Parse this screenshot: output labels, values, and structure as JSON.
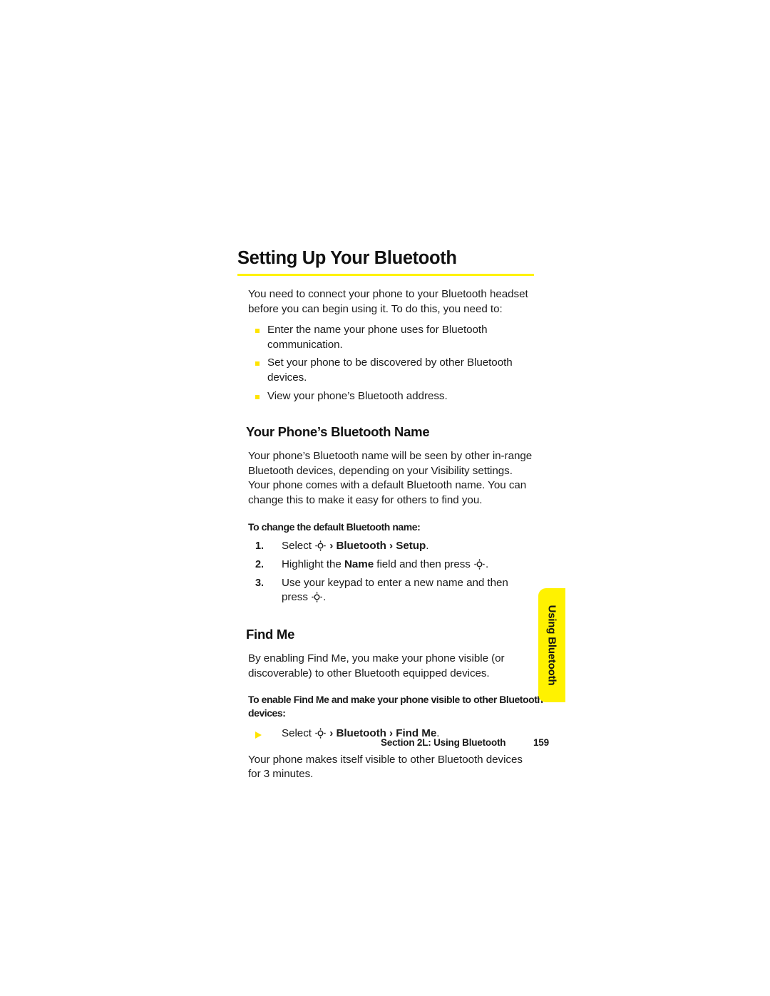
{
  "page": {
    "chapter_title": "Setting Up Your Bluetooth",
    "rule_color": "#fff200",
    "bullet_color": "#ffe400"
  },
  "intro": {
    "paragraph": "You need to connect your phone to your Bluetooth headset before you can begin using it. To do this, you need to:",
    "bullets": [
      "Enter the name your phone uses for Bluetooth communication.",
      "Set your phone to be discovered by other Bluetooth devices.",
      "View your phone’s Bluetooth address."
    ]
  },
  "bluetooth_name": {
    "heading": "Your Phone’s Bluetooth Name",
    "paragraph": "Your phone’s Bluetooth name will be seen by other in-range Bluetooth devices, depending on your Visibility settings. Your phone comes with a default Bluetooth name. You can change this to make it easy for others to find you.",
    "lead_in": "To change the default Bluetooth name:",
    "steps": [
      {
        "number": "1.",
        "pre": "Select ",
        "icon": "nav-key-icon",
        "post_plain_1": " ",
        "arrow_1": "›",
        "bold_1": "Bluetooth",
        "arrow_2": "›",
        "bold_2": "Setup",
        "tail": ".",
        "text": "Select [nav-key] › Bluetooth › Setup."
      },
      {
        "number": "2.",
        "text": "Highlight the Name field and then press [nav-key].",
        "pre": "Highlight the ",
        "bold_1": "Name",
        "mid": " field and then press ",
        "icon": "nav-key-icon",
        "tail": "."
      },
      {
        "number": "3.",
        "text": "Use your keypad to enter a new name and then press [nav-key].",
        "pre": "Use your keypad to enter a new name and then press ",
        "icon": "nav-key-icon",
        "tail": "."
      }
    ]
  },
  "find_me": {
    "heading": "Find Me",
    "paragraph": "By enabling Find Me, you make your phone visible (or discoverable) to other Bluetooth equipped devices.",
    "lead_in": "To enable Find Me and make your phone visible to other Bluetooth devices:",
    "bullet": {
      "pre": "Select ",
      "icon": "nav-key-icon",
      "arrow_1": "›",
      "bold_1": "Bluetooth",
      "arrow_2": "›",
      "bold_2": "Find Me",
      "tail": ".",
      "text": "Select [nav-key] › Bluetooth › Find Me."
    },
    "closing_paragraph": "Your phone makes itself visible to other Bluetooth devices for 3 minutes."
  },
  "side_tab": {
    "label": "Using Bluetooth",
    "color": "#fff200"
  },
  "footer": {
    "section": "Section 2L: Using Bluetooth",
    "page_number": "159"
  }
}
